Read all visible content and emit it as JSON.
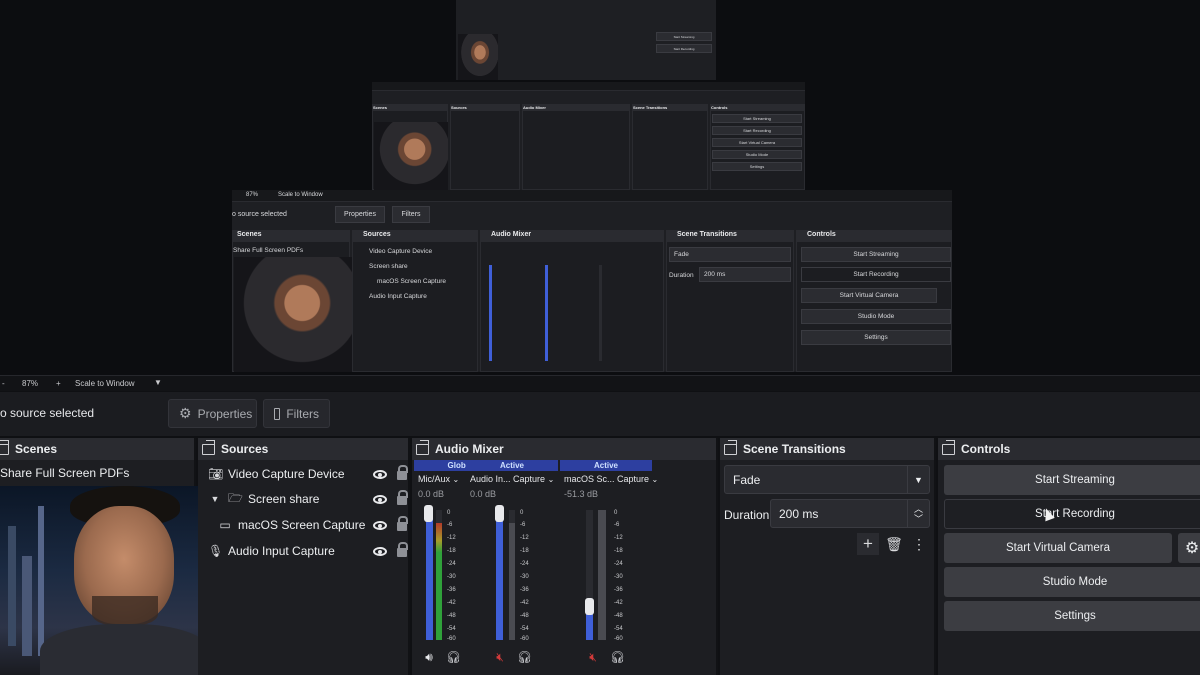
{
  "preview": {
    "mini2": {
      "no_source": "o source selected",
      "properties": "Properties",
      "filters": "Filters",
      "zoom": "87%",
      "scale": "Scale to Window",
      "scenes_title": "Scenes",
      "scene_item": "Share Full Screen PDFs",
      "sources_title": "Sources",
      "sources": [
        "Video Capture Device",
        "Screen share",
        "macOS Screen Capture",
        "Audio Input Capture"
      ],
      "mixer_title": "Audio Mixer",
      "transitions_title": "Scene Transitions",
      "transition": "Fade",
      "duration_label": "Duration",
      "duration_value": "200 ms",
      "controls_title": "Controls",
      "controls": [
        "Start Streaming",
        "Start Recording",
        "Start Virtual Camera",
        "Studio Mode",
        "Settings"
      ]
    }
  },
  "zoombar": {
    "minus": "-",
    "zoom": "87%",
    "plus": "+",
    "scale": "Scale to Window"
  },
  "source_bar": {
    "no_source": "o source selected",
    "properties": "Properties",
    "filters": "Filters"
  },
  "scenes": {
    "title": "Scenes",
    "item": "Share Full Screen PDFs"
  },
  "sources": {
    "title": "Sources",
    "items": [
      {
        "label": "Video Capture Device",
        "icon": "camera-icon"
      },
      {
        "label": "Screen share",
        "icon": "folder-icon"
      },
      {
        "label": "macOS Screen Capture",
        "icon": "monitor-icon"
      },
      {
        "label": "Audio Input Capture",
        "icon": "microphone-icon"
      }
    ]
  },
  "mixer": {
    "title": "Audio Mixer",
    "channels": [
      {
        "tag": "Global",
        "name": "Mic/Aux",
        "db": "0.0 dB",
        "level": 0.9
      },
      {
        "tag": "Active",
        "name": "Audio In... Capture",
        "db": "0.0 dB",
        "level": 0.9
      },
      {
        "tag": "Active",
        "name": "macOS Sc... Capture",
        "db": "-51.3 dB",
        "level": 0.2
      }
    ],
    "scale": [
      "0",
      "-6",
      "-12",
      "-18",
      "-24",
      "-30",
      "-36",
      "-42",
      "-48",
      "-54",
      "-60"
    ]
  },
  "transitions": {
    "title": "Scene Transitions",
    "selected": "Fade",
    "duration_label": "Duration",
    "duration_value": "200 ms"
  },
  "controls": {
    "title": "Controls",
    "start_streaming": "Start Streaming",
    "start_recording": "Start Recording",
    "start_virtual_camera": "Start Virtual Camera",
    "studio_mode": "Studio Mode",
    "settings": "Settings"
  },
  "colors": {
    "accent_blue": "#2d3fa0",
    "meter_green": "#2fa13a",
    "meter_blue": "#3f5fd8",
    "muted_red": "#d23a3a"
  }
}
